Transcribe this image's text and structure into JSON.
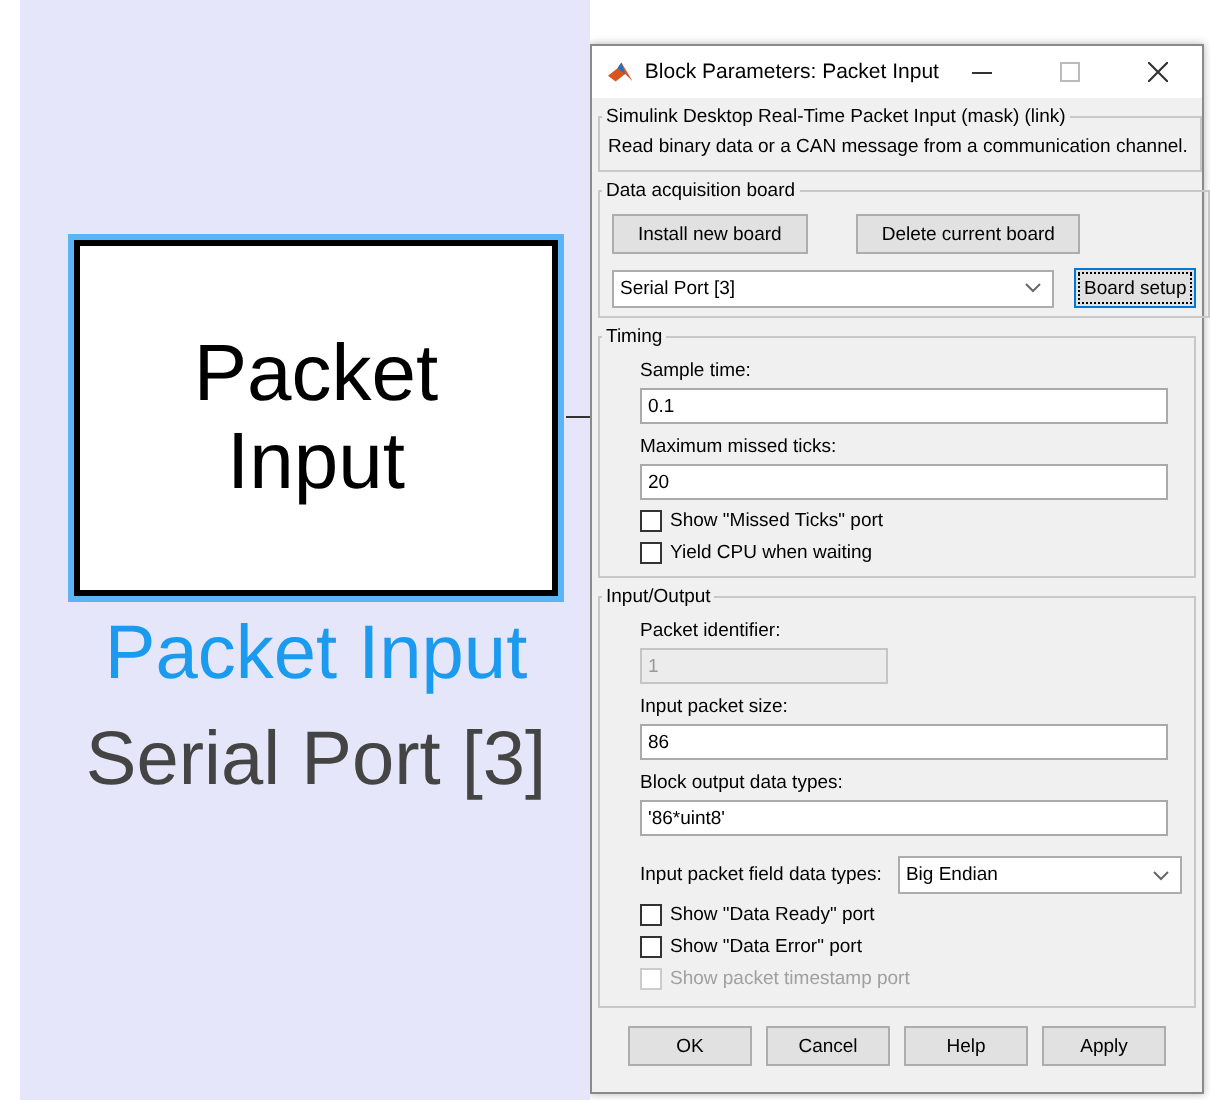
{
  "canvas": {
    "block": {
      "lines": [
        "Packet",
        "Input"
      ],
      "selected": true
    },
    "name": "Packet Input",
    "annotation": "Serial Port [3]"
  },
  "dialog": {
    "title": "Block Parameters: Packet Input",
    "mask_group": {
      "title": "Simulink Desktop Real-Time Packet Input (mask) (link)",
      "description": "Read binary data or a CAN message from a communication channel."
    },
    "board_group": {
      "title": "Data acquisition board",
      "buttons": [
        "Install new board",
        "Delete current board"
      ],
      "board": {
        "value": "Serial Port [3]"
      },
      "setup_button": {
        "label": "Board setup",
        "focused": true
      }
    },
    "timing_group": {
      "title": "Timing",
      "fields": [
        {
          "kind": "text",
          "label": "Sample time:",
          "value": "0.1",
          "disabled": false
        },
        {
          "kind": "text",
          "label": "Maximum missed ticks:",
          "value": "20",
          "disabled": false
        }
      ],
      "checkboxes": [
        {
          "label": "Show \"Missed Ticks\" port",
          "checked": false,
          "disabled": false
        },
        {
          "label": "Yield CPU when waiting",
          "checked": false,
          "disabled": false
        }
      ]
    },
    "io_group": {
      "title": "Input/Output",
      "fields": [
        {
          "kind": "short",
          "label": "Packet identifier:",
          "value": "1",
          "disabled": true
        },
        {
          "kind": "text",
          "label": "Input packet size:",
          "value": "86",
          "disabled": false
        },
        {
          "kind": "text",
          "label": "Block output data types:",
          "value": "'86*uint8'",
          "disabled": false
        },
        {
          "kind": "dropdown",
          "label": "Input packet field data types:",
          "value": "Big Endian",
          "disabled": false
        }
      ],
      "checkboxes": [
        {
          "label": "Show \"Data Ready\" port",
          "checked": false,
          "disabled": false
        },
        {
          "label": "Show \"Data Error\" port",
          "checked": false,
          "disabled": false
        },
        {
          "label": "Show packet timestamp port",
          "checked": false,
          "disabled": true
        }
      ]
    },
    "buttons": [
      "OK",
      "Cancel",
      "Help",
      "Apply"
    ]
  }
}
